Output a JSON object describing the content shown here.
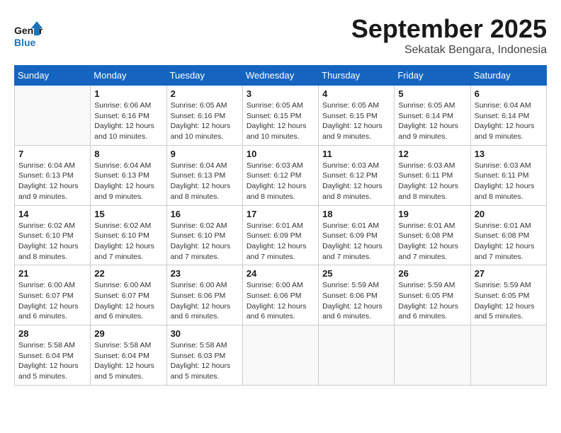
{
  "header": {
    "logo_line1": "General",
    "logo_line2": "Blue",
    "month": "September 2025",
    "location": "Sekatak Bengara, Indonesia"
  },
  "days_of_week": [
    "Sunday",
    "Monday",
    "Tuesday",
    "Wednesday",
    "Thursday",
    "Friday",
    "Saturday"
  ],
  "weeks": [
    [
      {
        "day": "",
        "info": ""
      },
      {
        "day": "1",
        "info": "Sunrise: 6:06 AM\nSunset: 6:16 PM\nDaylight: 12 hours\nand 10 minutes."
      },
      {
        "day": "2",
        "info": "Sunrise: 6:05 AM\nSunset: 6:16 PM\nDaylight: 12 hours\nand 10 minutes."
      },
      {
        "day": "3",
        "info": "Sunrise: 6:05 AM\nSunset: 6:15 PM\nDaylight: 12 hours\nand 10 minutes."
      },
      {
        "day": "4",
        "info": "Sunrise: 6:05 AM\nSunset: 6:15 PM\nDaylight: 12 hours\nand 9 minutes."
      },
      {
        "day": "5",
        "info": "Sunrise: 6:05 AM\nSunset: 6:14 PM\nDaylight: 12 hours\nand 9 minutes."
      },
      {
        "day": "6",
        "info": "Sunrise: 6:04 AM\nSunset: 6:14 PM\nDaylight: 12 hours\nand 9 minutes."
      }
    ],
    [
      {
        "day": "7",
        "info": "Sunrise: 6:04 AM\nSunset: 6:13 PM\nDaylight: 12 hours\nand 9 minutes."
      },
      {
        "day": "8",
        "info": "Sunrise: 6:04 AM\nSunset: 6:13 PM\nDaylight: 12 hours\nand 9 minutes."
      },
      {
        "day": "9",
        "info": "Sunrise: 6:04 AM\nSunset: 6:13 PM\nDaylight: 12 hours\nand 8 minutes."
      },
      {
        "day": "10",
        "info": "Sunrise: 6:03 AM\nSunset: 6:12 PM\nDaylight: 12 hours\nand 8 minutes."
      },
      {
        "day": "11",
        "info": "Sunrise: 6:03 AM\nSunset: 6:12 PM\nDaylight: 12 hours\nand 8 minutes."
      },
      {
        "day": "12",
        "info": "Sunrise: 6:03 AM\nSunset: 6:11 PM\nDaylight: 12 hours\nand 8 minutes."
      },
      {
        "day": "13",
        "info": "Sunrise: 6:03 AM\nSunset: 6:11 PM\nDaylight: 12 hours\nand 8 minutes."
      }
    ],
    [
      {
        "day": "14",
        "info": "Sunrise: 6:02 AM\nSunset: 6:10 PM\nDaylight: 12 hours\nand 8 minutes."
      },
      {
        "day": "15",
        "info": "Sunrise: 6:02 AM\nSunset: 6:10 PM\nDaylight: 12 hours\nand 7 minutes."
      },
      {
        "day": "16",
        "info": "Sunrise: 6:02 AM\nSunset: 6:10 PM\nDaylight: 12 hours\nand 7 minutes."
      },
      {
        "day": "17",
        "info": "Sunrise: 6:01 AM\nSunset: 6:09 PM\nDaylight: 12 hours\nand 7 minutes."
      },
      {
        "day": "18",
        "info": "Sunrise: 6:01 AM\nSunset: 6:09 PM\nDaylight: 12 hours\nand 7 minutes."
      },
      {
        "day": "19",
        "info": "Sunrise: 6:01 AM\nSunset: 6:08 PM\nDaylight: 12 hours\nand 7 minutes."
      },
      {
        "day": "20",
        "info": "Sunrise: 6:01 AM\nSunset: 6:08 PM\nDaylight: 12 hours\nand 7 minutes."
      }
    ],
    [
      {
        "day": "21",
        "info": "Sunrise: 6:00 AM\nSunset: 6:07 PM\nDaylight: 12 hours\nand 6 minutes."
      },
      {
        "day": "22",
        "info": "Sunrise: 6:00 AM\nSunset: 6:07 PM\nDaylight: 12 hours\nand 6 minutes."
      },
      {
        "day": "23",
        "info": "Sunrise: 6:00 AM\nSunset: 6:06 PM\nDaylight: 12 hours\nand 6 minutes."
      },
      {
        "day": "24",
        "info": "Sunrise: 6:00 AM\nSunset: 6:06 PM\nDaylight: 12 hours\nand 6 minutes."
      },
      {
        "day": "25",
        "info": "Sunrise: 5:59 AM\nSunset: 6:06 PM\nDaylight: 12 hours\nand 6 minutes."
      },
      {
        "day": "26",
        "info": "Sunrise: 5:59 AM\nSunset: 6:05 PM\nDaylight: 12 hours\nand 6 minutes."
      },
      {
        "day": "27",
        "info": "Sunrise: 5:59 AM\nSunset: 6:05 PM\nDaylight: 12 hours\nand 5 minutes."
      }
    ],
    [
      {
        "day": "28",
        "info": "Sunrise: 5:58 AM\nSunset: 6:04 PM\nDaylight: 12 hours\nand 5 minutes."
      },
      {
        "day": "29",
        "info": "Sunrise: 5:58 AM\nSunset: 6:04 PM\nDaylight: 12 hours\nand 5 minutes."
      },
      {
        "day": "30",
        "info": "Sunrise: 5:58 AM\nSunset: 6:03 PM\nDaylight: 12 hours\nand 5 minutes."
      },
      {
        "day": "",
        "info": ""
      },
      {
        "day": "",
        "info": ""
      },
      {
        "day": "",
        "info": ""
      },
      {
        "day": "",
        "info": ""
      }
    ]
  ]
}
